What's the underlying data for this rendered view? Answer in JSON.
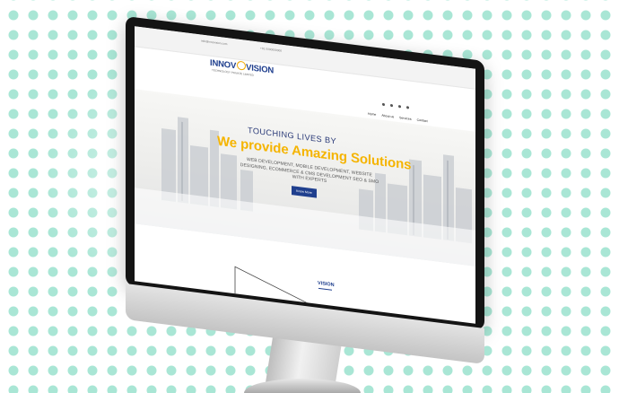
{
  "topbar": {
    "email": "info@innovision.com",
    "phone": "+91 0000000000"
  },
  "logo": {
    "part1": "INNOV",
    "part2": "VISION",
    "subtitle": "TECHNOLOGY PRIVATE LIMITED"
  },
  "nav": {
    "items": [
      "Home",
      "About us",
      "Services",
      "Contact"
    ]
  },
  "hero": {
    "line1": "TOUCHING LIVES BY",
    "line2": "We provide Amazing Solutions",
    "services": "WEB DEVELOPMENT, MOBILE DEVELOPMENT, WEBSITE DESIGNING, ECOMMERCE & CMS DEVELOPMENT SEO & SMO WITH EXPERTS",
    "button_label": "Know More"
  },
  "vision": {
    "title": "VISION"
  },
  "colors": {
    "brand_blue": "#1f3f8e",
    "accent_yellow": "#f5b400",
    "dot_teal": "#a9e6d5"
  }
}
